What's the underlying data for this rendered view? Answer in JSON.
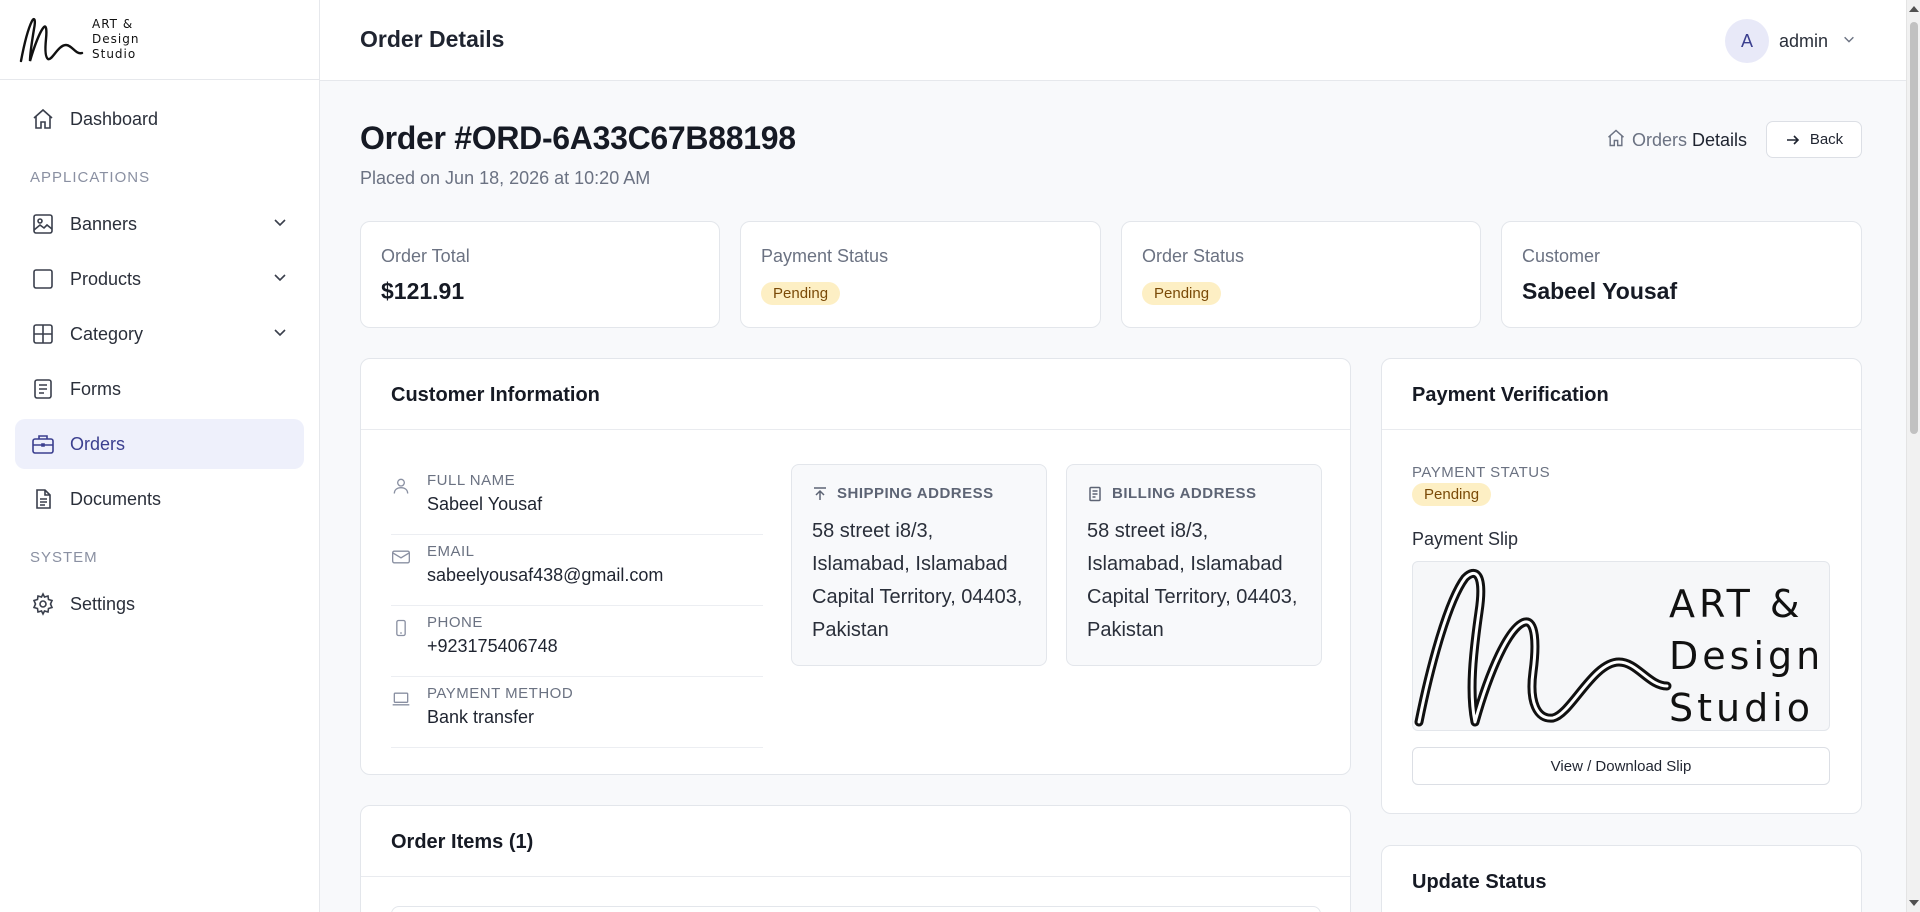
{
  "brand": {
    "line1": "ART &",
    "line2": "Design",
    "line3": "Studio"
  },
  "sidebar": {
    "items": [
      {
        "label": "Dashboard"
      },
      {
        "section": "APPLICATIONS"
      },
      {
        "label": "Banners"
      },
      {
        "label": "Products"
      },
      {
        "label": "Category"
      },
      {
        "label": "Forms"
      },
      {
        "label": "Orders"
      },
      {
        "label": "Documents"
      },
      {
        "section": "SYSTEM"
      },
      {
        "label": "Settings"
      }
    ]
  },
  "topbar": {
    "title": "Order Details",
    "avatar_initial": "A",
    "username": "admin"
  },
  "order": {
    "title": "Order #ORD-6A33C67B88198",
    "placed": "Placed on Jun 18, 2026 at 10:20 AM"
  },
  "breadcrumb": {
    "root": "Orders",
    "current": "Details"
  },
  "back_label": "Back",
  "stats": [
    {
      "label": "Order Total",
      "value": "$121.91"
    },
    {
      "label": "Payment Status",
      "value": "Pending"
    },
    {
      "label": "Order Status",
      "value": "Pending"
    },
    {
      "label": "Customer",
      "value": "Sabeel Yousaf"
    }
  ],
  "customer_info": {
    "title": "Customer Information",
    "fields": [
      {
        "key": "FULL NAME",
        "value": "Sabeel Yousaf"
      },
      {
        "key": "EMAIL",
        "value": "sabeelyousaf438@gmail.com"
      },
      {
        "key": "PHONE",
        "value": "+923175406748"
      },
      {
        "key": "PAYMENT METHOD",
        "value": "Bank transfer"
      }
    ],
    "shipping": {
      "label": "SHIPPING ADDRESS",
      "value": "58 street i8/3, Islamabad, Islamabad Capital Territory, 04403, Pakistan"
    },
    "billing": {
      "label": "BILLING ADDRESS",
      "value": "58 street i8/3, Islamabad, Islamabad Capital Territory, 04403, Pakistan"
    }
  },
  "payment_verification": {
    "title": "Payment Verification",
    "status_label": "PAYMENT STATUS",
    "status": "Pending",
    "slip_label": "Payment Slip",
    "slip_text": {
      "line1": "ART &",
      "line2": "Design",
      "line3": "Studio"
    },
    "slip_button": "View / Download Slip"
  },
  "order_items": {
    "title": "Order Items (1)"
  },
  "update_status": {
    "title": "Update Status"
  },
  "colors": {
    "accent": "#3b3f8f",
    "active_bg": "#eef0fb",
    "badge_bg": "#fdefc4",
    "badge_text": "#7a4a08"
  }
}
